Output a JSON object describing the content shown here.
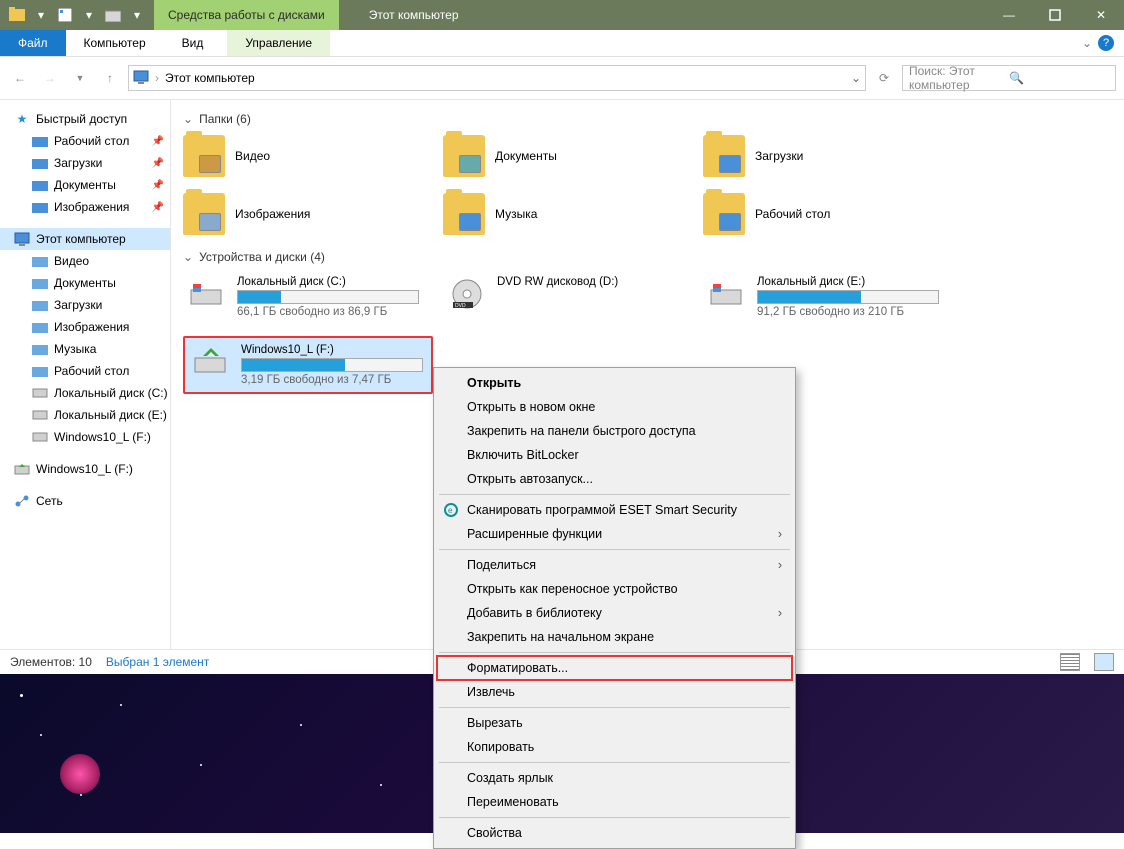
{
  "titlebar": {
    "context_tab": "Средства работы с дисками",
    "title": "Этот компьютер"
  },
  "ribbon": {
    "file": "Файл",
    "computer": "Компьютер",
    "view": "Вид",
    "manage": "Управление"
  },
  "address": {
    "location": "Этот компьютер"
  },
  "search": {
    "placeholder": "Поиск: Этот компьютер"
  },
  "sidebar": {
    "quick_access": "Быстрый доступ",
    "quick_items": [
      "Рабочий стол",
      "Загрузки",
      "Документы",
      "Изображения"
    ],
    "this_pc": "Этот компьютер",
    "pc_items": [
      "Видео",
      "Документы",
      "Загрузки",
      "Изображения",
      "Музыка",
      "Рабочий стол",
      "Локальный диск (C:)",
      "Локальный диск (E:)",
      "Windows10_L (F:)"
    ],
    "extra": "Windows10_L (F:)",
    "network": "Сеть"
  },
  "groups": {
    "folders_label": "Папки (6)",
    "drives_label": "Устройства и диски (4)"
  },
  "folders": [
    "Видео",
    "Документы",
    "Загрузки",
    "Изображения",
    "Музыка",
    "Рабочий стол"
  ],
  "drives": [
    {
      "name": "Локальный диск (C:)",
      "sub": "66,1 ГБ свободно из 86,9 ГБ",
      "fill": 24
    },
    {
      "name": "DVD RW дисковод (D:)",
      "sub": "",
      "fill": null,
      "kind": "dvd"
    },
    {
      "name": "Локальный диск (E:)",
      "sub": "91,2 ГБ свободно из 210 ГБ",
      "fill": 57
    },
    {
      "name": "Windows10_L (F:)",
      "sub": "3,19 ГБ свободно из 7,47 ГБ",
      "fill": 57,
      "selected": true,
      "kind": "usb"
    }
  ],
  "status": {
    "count": "Элементов: 10",
    "selected": "Выбран 1 элемент"
  },
  "context_menu": [
    {
      "label": "Открыть",
      "bold": true
    },
    {
      "label": "Открыть в новом окне"
    },
    {
      "label": "Закрепить на панели быстрого доступа"
    },
    {
      "label": "Включить BitLocker"
    },
    {
      "label": "Открыть автозапуск..."
    },
    {
      "sep": true
    },
    {
      "label": "Сканировать программой ESET Smart Security",
      "icon": "eset"
    },
    {
      "label": "Расширенные функции",
      "submenu": true
    },
    {
      "sep": true
    },
    {
      "label": "Поделиться",
      "submenu": true
    },
    {
      "label": "Открыть как переносное устройство"
    },
    {
      "label": "Добавить в библиотеку",
      "submenu": true
    },
    {
      "label": "Закрепить на начальном экране"
    },
    {
      "sep": true
    },
    {
      "label": "Форматировать...",
      "hl": true
    },
    {
      "label": "Извлечь"
    },
    {
      "sep": true
    },
    {
      "label": "Вырезать"
    },
    {
      "label": "Копировать"
    },
    {
      "sep": true
    },
    {
      "label": "Создать ярлык"
    },
    {
      "label": "Переименовать"
    },
    {
      "sep": true
    },
    {
      "label": "Свойства"
    }
  ]
}
